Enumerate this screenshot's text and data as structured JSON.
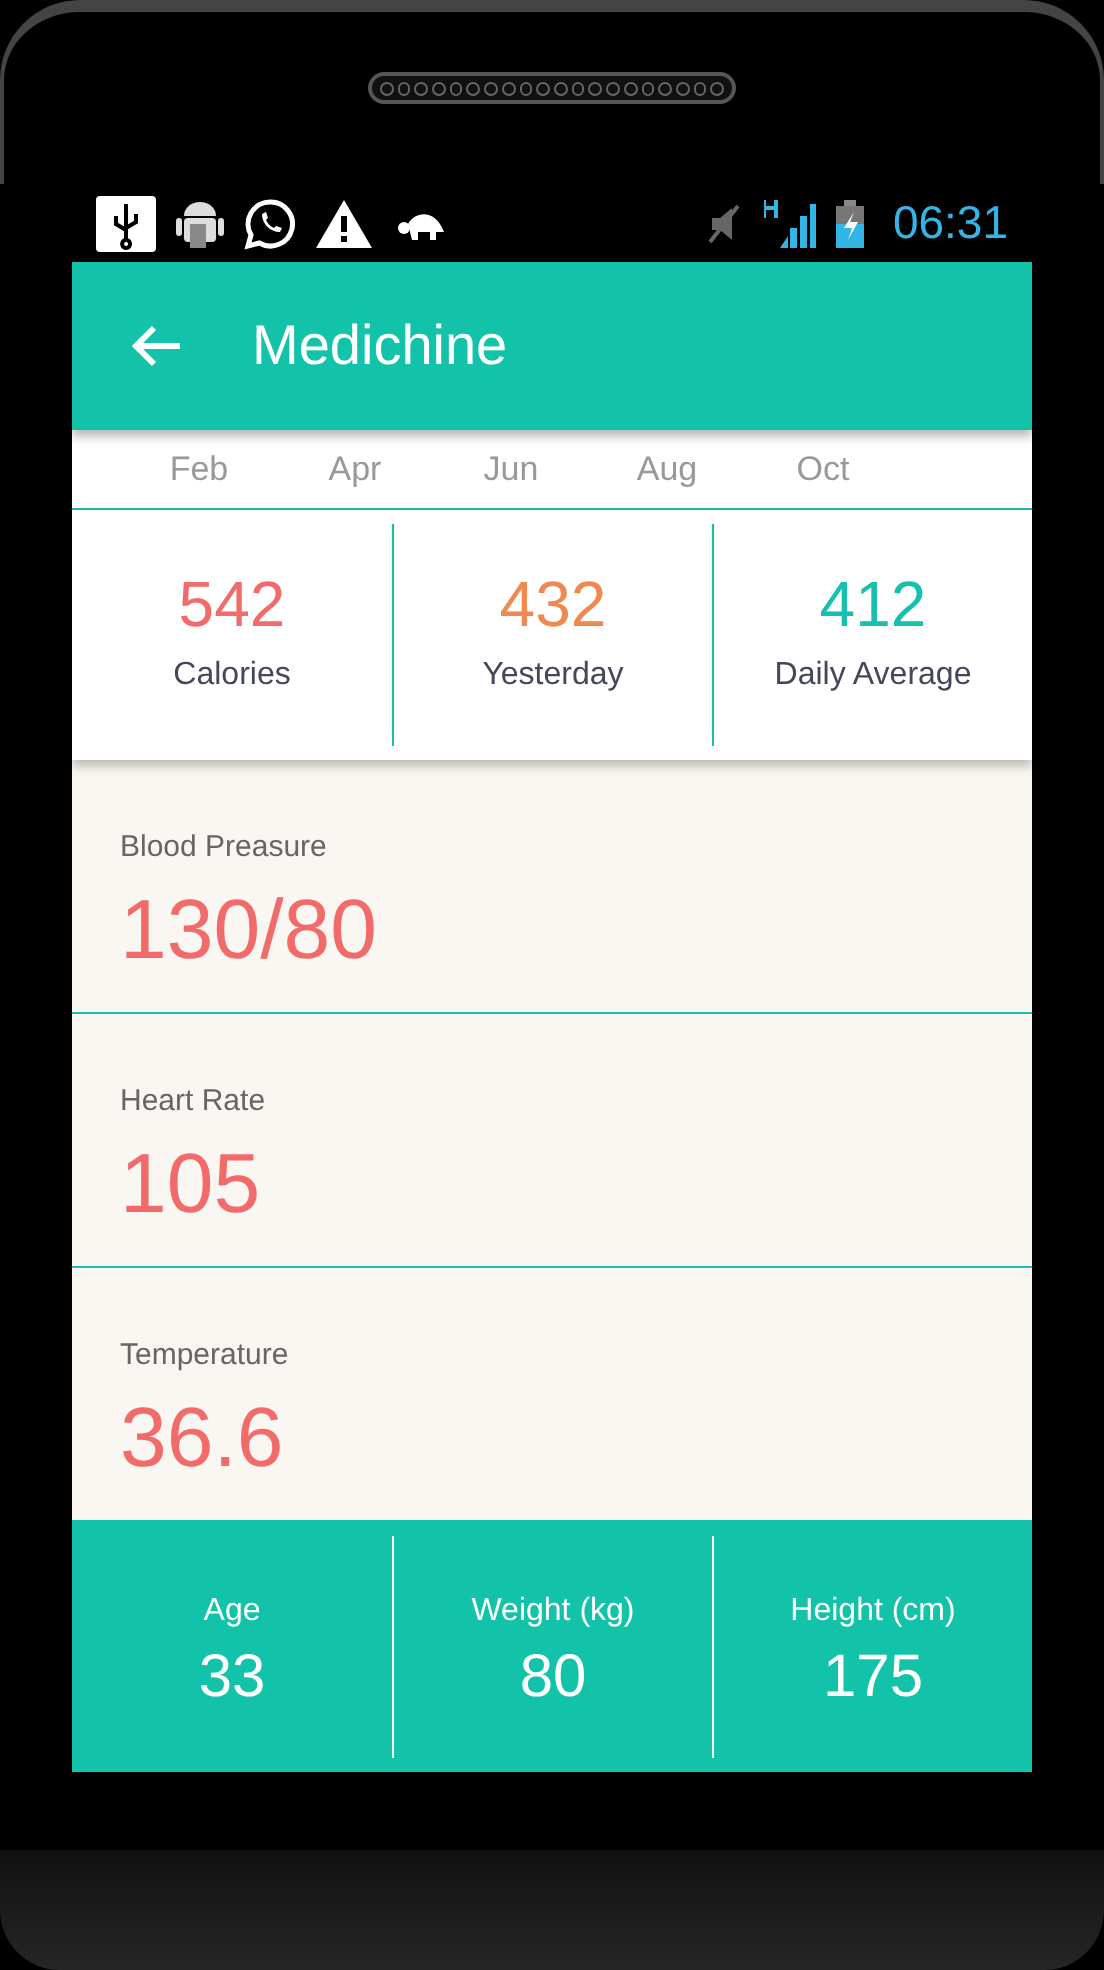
{
  "status_bar": {
    "time": "06:31"
  },
  "app_bar": {
    "title": "Medichine"
  },
  "month_labels": [
    "Feb",
    "Apr",
    "Jun",
    "Aug",
    "Oct"
  ],
  "stats": [
    {
      "value": "542",
      "label": "Calories",
      "color": "#f26b6b"
    },
    {
      "value": "432",
      "label": "Yesterday",
      "color": "#f0894f"
    },
    {
      "value": "412",
      "label": "Daily Average",
      "color": "#16bfae"
    }
  ],
  "vitals": [
    {
      "label": "Blood Preasure",
      "value": "130/80"
    },
    {
      "label": "Heart Rate",
      "value": "105"
    },
    {
      "label": "Temperature",
      "value": "36.6"
    }
  ],
  "profile": [
    {
      "label": "Age",
      "value": "33"
    },
    {
      "label": "Weight (kg)",
      "value": "80"
    },
    {
      "label": "Height (cm)",
      "value": "175"
    }
  ]
}
